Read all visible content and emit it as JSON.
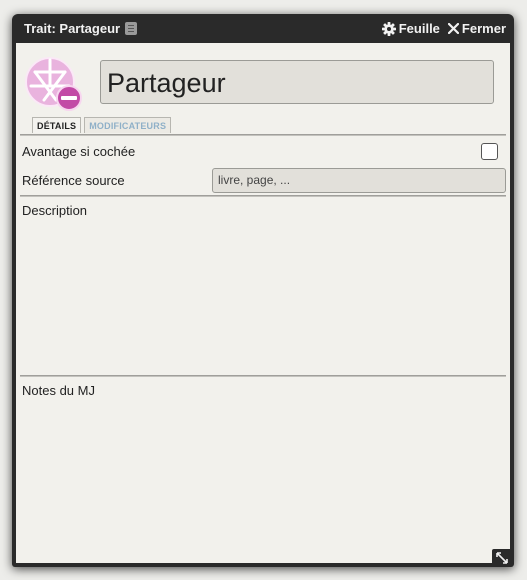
{
  "window": {
    "title": "Trait: Partageur",
    "sheet_label": "Feuille",
    "close_label": "Fermer"
  },
  "record": {
    "name": "Partageur"
  },
  "tabs": [
    {
      "label": "DÉTAILS",
      "active": true
    },
    {
      "label": "MODIFICATEURS",
      "active": false
    }
  ],
  "fields": {
    "advantage_label": "Avantage si cochée",
    "advantage_checked": false,
    "source_label": "Référence source",
    "source_placeholder": "livre, page, ...",
    "description_label": "Description",
    "gm_notes_label": "Notes du MJ"
  },
  "icons": {
    "title_book": "book-icon",
    "sheet": "gear-icon",
    "close": "close-icon",
    "emblem": "trait-emblem-icon",
    "emblem_badge": "minus-badge-icon",
    "resize": "resize-icon"
  },
  "colors": {
    "frame": "#2a2a2a",
    "paper": "#f2f1ec",
    "emblem": "#d86bc6",
    "badge": "#c24aa6",
    "inactive_tab": "#8fb0c8"
  }
}
